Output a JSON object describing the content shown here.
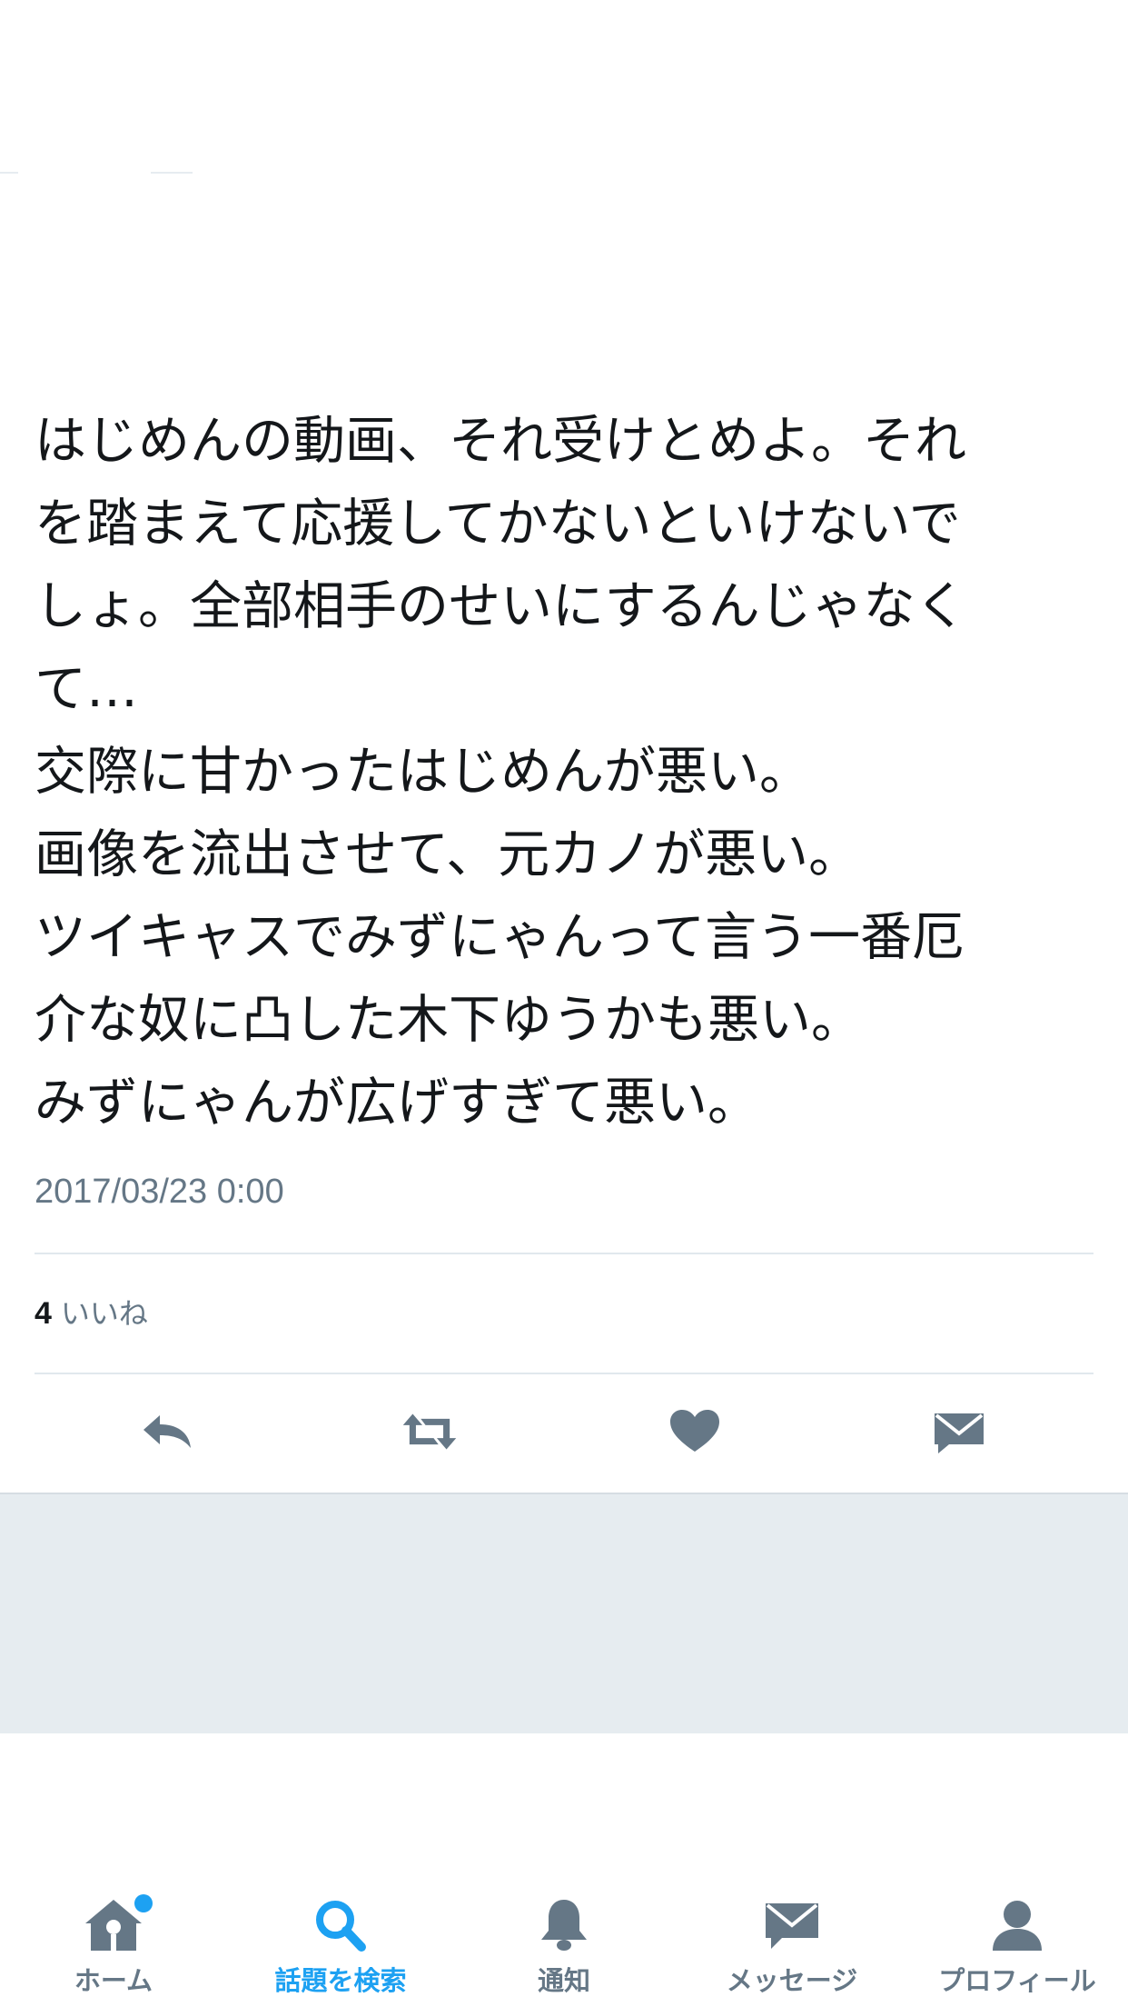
{
  "tweet": {
    "text_lines": [
      "はじめんの動画、それ受けとめよ。それ",
      "を踏まえて応援してかないといけないで",
      "しょ。全部相手のせいにするんじゃなく",
      "て…",
      "交際に甘かったはじめんが悪い。",
      "画像を流出させて、元カノが悪い。",
      "ツイキャスでみずにゃんって言う一番厄",
      "介な奴に凸した木下ゆうかも悪い。",
      "みずにゃんが広げすぎて悪い。"
    ],
    "timestamp": "2017/03/23 0:00",
    "likes_count": "4",
    "likes_label": "いいね"
  },
  "actions": {
    "icons": [
      "reply-icon",
      "retweet-icon",
      "like-icon",
      "direct-message-icon"
    ]
  },
  "tabbar": {
    "items": [
      {
        "label": "ホーム",
        "icon": "home-icon",
        "active": false,
        "badge": true
      },
      {
        "label": "話題を検索",
        "icon": "search-icon",
        "active": true,
        "badge": false
      },
      {
        "label": "通知",
        "icon": "bell-icon",
        "active": false,
        "badge": false
      },
      {
        "label": "メッセージ",
        "icon": "envelope-icon",
        "active": false,
        "badge": false
      },
      {
        "label": "プロフィール",
        "icon": "profile-icon",
        "active": false,
        "badge": false
      }
    ]
  },
  "colors": {
    "accent": "#1da1f2",
    "icon_gray": "#657786",
    "text": "#14171a",
    "background_band": "#e6ecf0"
  }
}
